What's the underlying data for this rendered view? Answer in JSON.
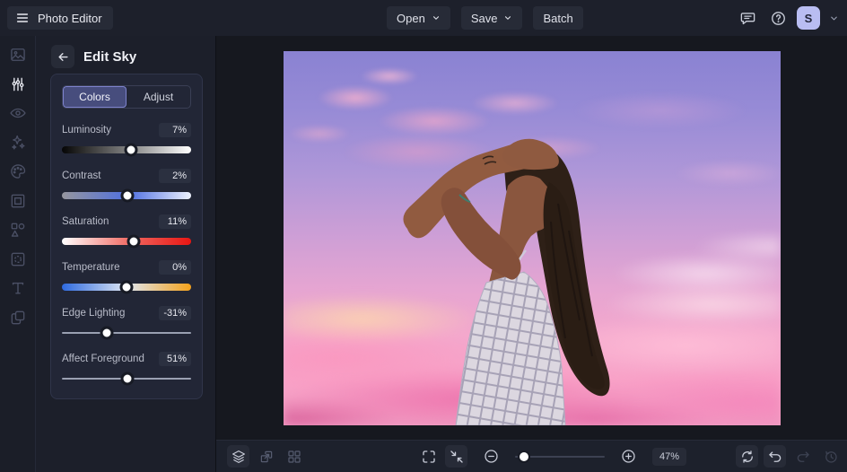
{
  "topbar": {
    "app_title": "Photo Editor",
    "open_label": "Open",
    "save_label": "Save",
    "batch_label": "Batch",
    "avatar_letter": "S",
    "icons": [
      "menu-icon",
      "comment-icon",
      "help-icon",
      "chevron-down-icon"
    ]
  },
  "sidebar": {
    "items": [
      {
        "icon": "photo-icon",
        "active": false
      },
      {
        "icon": "adjust-sliders-icon",
        "active": true
      },
      {
        "icon": "eye-icon",
        "active": false
      },
      {
        "icon": "effects-sparkles-icon",
        "active": false
      },
      {
        "icon": "palette-icon",
        "active": false
      },
      {
        "icon": "frame-icon",
        "active": false
      },
      {
        "icon": "shapes-icon",
        "active": false
      },
      {
        "icon": "texture-icon",
        "active": false
      },
      {
        "icon": "text-icon",
        "active": false
      },
      {
        "icon": "copies-icon",
        "active": false
      }
    ]
  },
  "panel": {
    "title": "Edit Sky",
    "tabs": [
      {
        "label": "Colors",
        "active": true
      },
      {
        "label": "Adjust",
        "active": false
      }
    ],
    "sliders": [
      {
        "label": "Luminosity",
        "value": "7%",
        "percent": 53.5,
        "track": "luminosity"
      },
      {
        "label": "Contrast",
        "value": "2%",
        "percent": 51,
        "track": "contrast"
      },
      {
        "label": "Saturation",
        "value": "11%",
        "percent": 55.5,
        "track": "saturation"
      },
      {
        "label": "Temperature",
        "value": "0%",
        "percent": 50,
        "track": "temperature"
      },
      {
        "label": "Edge Lighting",
        "value": "-31%",
        "percent": 34.5,
        "track": "plain"
      },
      {
        "label": "Affect Foreground",
        "value": "51%",
        "percent": 51,
        "track": "plain"
      }
    ]
  },
  "bottombar": {
    "zoom_value": "47%",
    "zoom_knob_percent": 10,
    "icons_left": [
      "layers-icon",
      "resize-icon",
      "grid-icon"
    ],
    "icons_center": [
      "expand-icon",
      "fit-screen-icon",
      "zoom-out-icon",
      "zoom-in-icon"
    ],
    "icons_right": [
      "sync-icon",
      "undo-icon",
      "redo-icon",
      "history-icon"
    ]
  },
  "colors": {
    "avatar_bg": "#b9bdf2",
    "tab_active_bg": "#474d7d",
    "topbar_bg": "#1d202b",
    "panel_card_bg": "#222636"
  }
}
